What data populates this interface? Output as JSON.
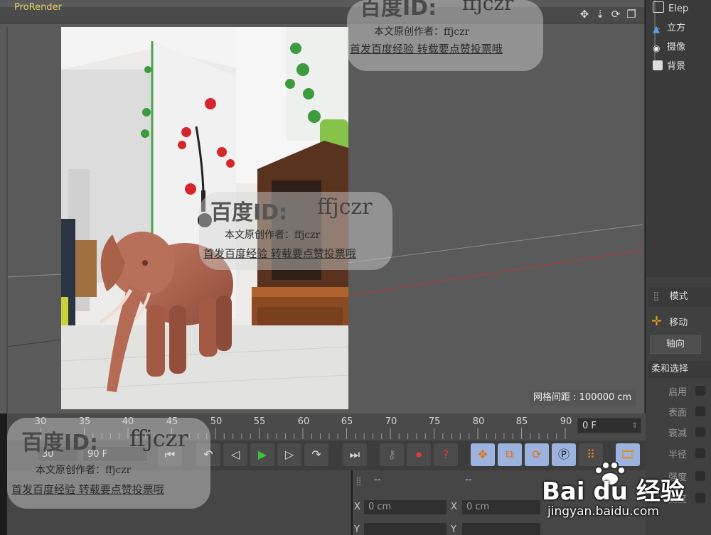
{
  "window": {
    "title": "ProRender"
  },
  "viewport": {
    "grid_label": "网格间距 : 100000 cm"
  },
  "objects": [
    {
      "label": "Elep",
      "icon": "object-icon"
    },
    {
      "label": "立方",
      "icon": "cube-icon"
    },
    {
      "label": "摄像",
      "icon": "camera-icon"
    },
    {
      "label": "背景",
      "icon": "background-icon"
    }
  ],
  "attributes": {
    "mode_label": "模式",
    "move_label": "移动",
    "axis_button": "轴向",
    "soft_select_header": "柔和选择",
    "rows": [
      "启用",
      "表面",
      "衰减",
      "半径",
      "强度",
      "宽度"
    ]
  },
  "timeline": {
    "ticks": [
      "30",
      "35",
      "40",
      "45",
      "50",
      "55",
      "60",
      "65",
      "70",
      "75",
      "80",
      "85",
      "90"
    ],
    "current_frame": "0 F"
  },
  "transport": {
    "start_field": "30",
    "end_field": "90 F"
  },
  "coords": {
    "header_left": "--",
    "header_right": "--",
    "x_pos": "0 cm",
    "x_size": "0 cm",
    "label_x": "X",
    "label_y": "Y"
  },
  "watermark": {
    "id_big": "百度ID:",
    "id_name": "ffjczr",
    "line1": "本文原创作者：ffjczr",
    "line2": "首发百度经验 转载要点赞投票哦",
    "brand": "Bai du 经验",
    "brand_url": "jingyan.baidu.com"
  }
}
